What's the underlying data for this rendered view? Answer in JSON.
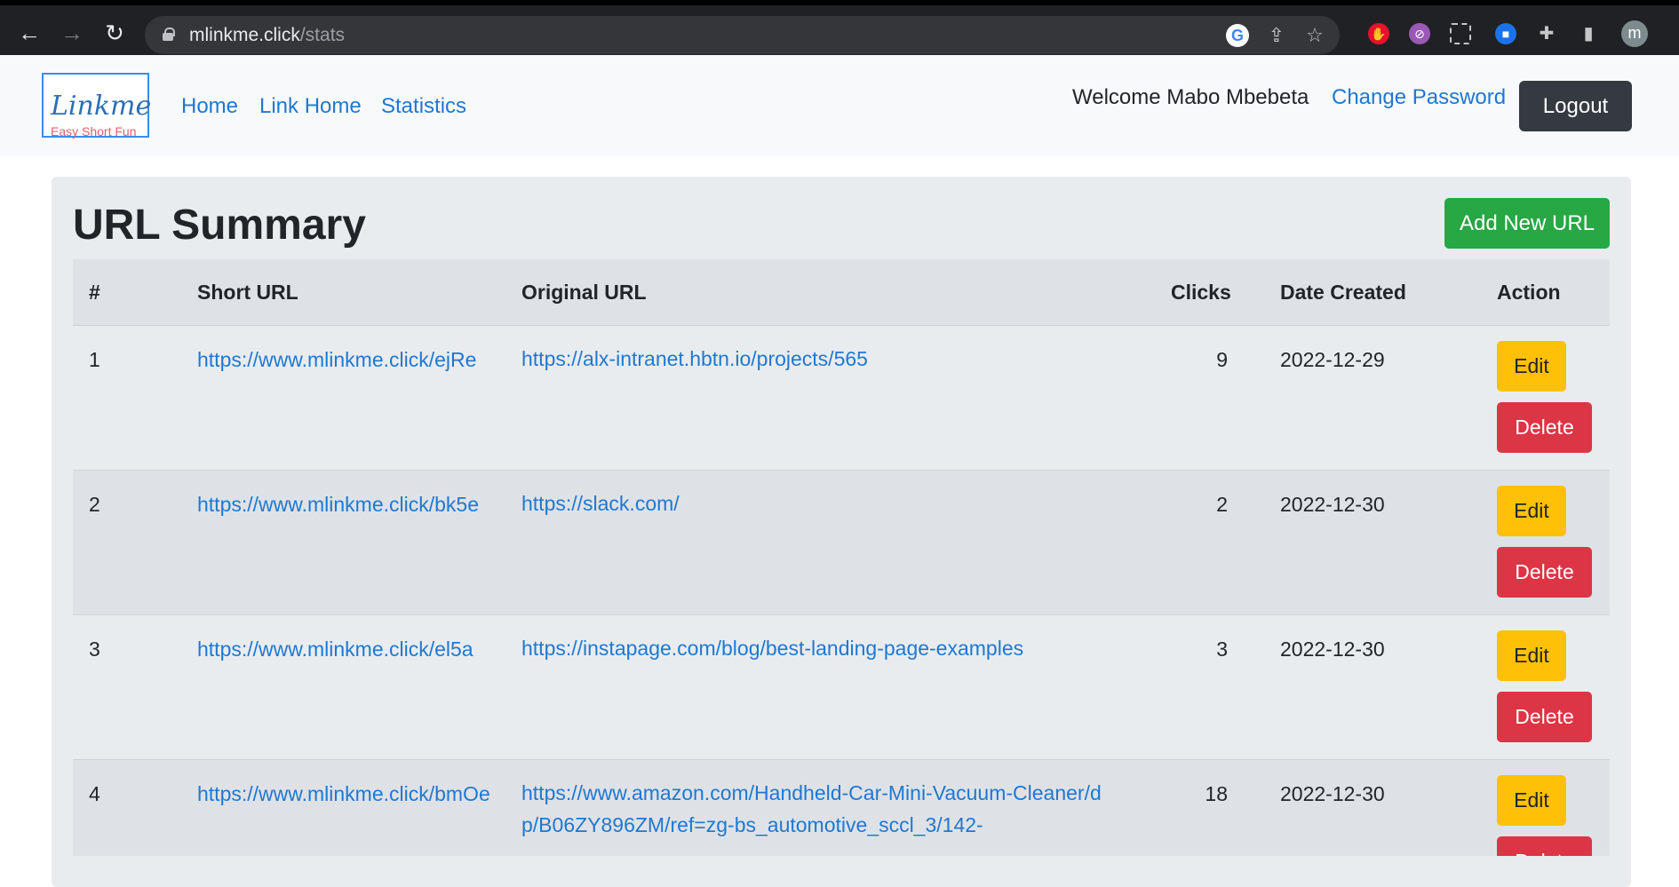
{
  "browser": {
    "url_host": "mlinkme.click",
    "url_path": "/stats",
    "back_icon": "←",
    "forward_icon": "→",
    "reload_icon": "↻",
    "share_icon": "⇪",
    "star_icon": "☆",
    "puzzle_icon": "✚",
    "sidepanel_icon": "▮",
    "avatar_letter": "m"
  },
  "navbar": {
    "logo_brand": "Linkme",
    "logo_tagline": "Easy Short Fun",
    "links": [
      "Home",
      "Link Home",
      "Statistics"
    ],
    "welcome": "Welcome Mabo Mbebeta",
    "change_password": "Change Password",
    "logout": "Logout"
  },
  "main": {
    "title_light": "URL",
    "title_bold": "Summary",
    "add_button": "Add New URL",
    "columns": [
      "#",
      "Short URL",
      "Original URL",
      "Clicks",
      "Date Created",
      "Action"
    ],
    "edit_label": "Edit",
    "delete_label": "Delete",
    "rows": [
      {
        "num": "1",
        "short": "https://www.mlinkme.click/ejRe",
        "original": "https://alx-intranet.hbtn.io/projects/565",
        "clicks": "9",
        "date": "2022-12-29"
      },
      {
        "num": "2",
        "short": "https://www.mlinkme.click/bk5e",
        "original": "https://slack.com/",
        "clicks": "2",
        "date": "2022-12-30"
      },
      {
        "num": "3",
        "short": "https://www.mlinkme.click/el5a",
        "original": "https://instapage.com/blog/best-landing-page-examples",
        "clicks": "3",
        "date": "2022-12-30"
      },
      {
        "num": "4",
        "short": "https://www.mlinkme.click/bmOe",
        "original": "https://www.amazon.com/Handheld-Car-Mini-Vacuum-Cleaner/dp/B06ZY896ZM/ref=zg-bs_automotive_sccl_3/142-",
        "clicks": "18",
        "date": "2022-12-30"
      }
    ]
  }
}
